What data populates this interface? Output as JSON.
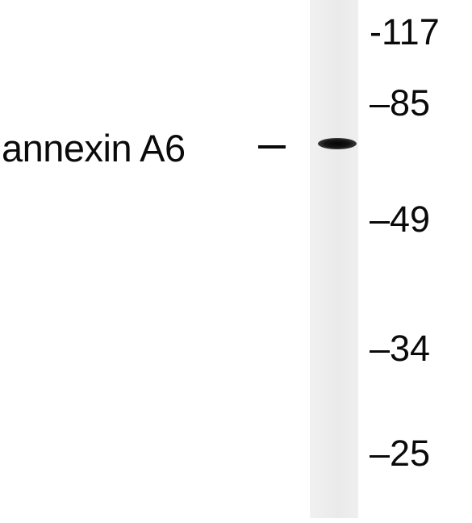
{
  "target": {
    "label": "annexin A6",
    "dash": "—"
  },
  "markers": [
    {
      "label": "-117",
      "kda": 117
    },
    {
      "label": "–85",
      "kda": 85
    },
    {
      "label": "–49",
      "kda": 49
    },
    {
      "label": "–34",
      "kda": 34
    },
    {
      "label": "–25",
      "kda": 25
    }
  ],
  "colors": {
    "background": "#ffffff",
    "lane": "#ececec",
    "band": "#0a0a0a",
    "text": "#0a0a0a"
  }
}
